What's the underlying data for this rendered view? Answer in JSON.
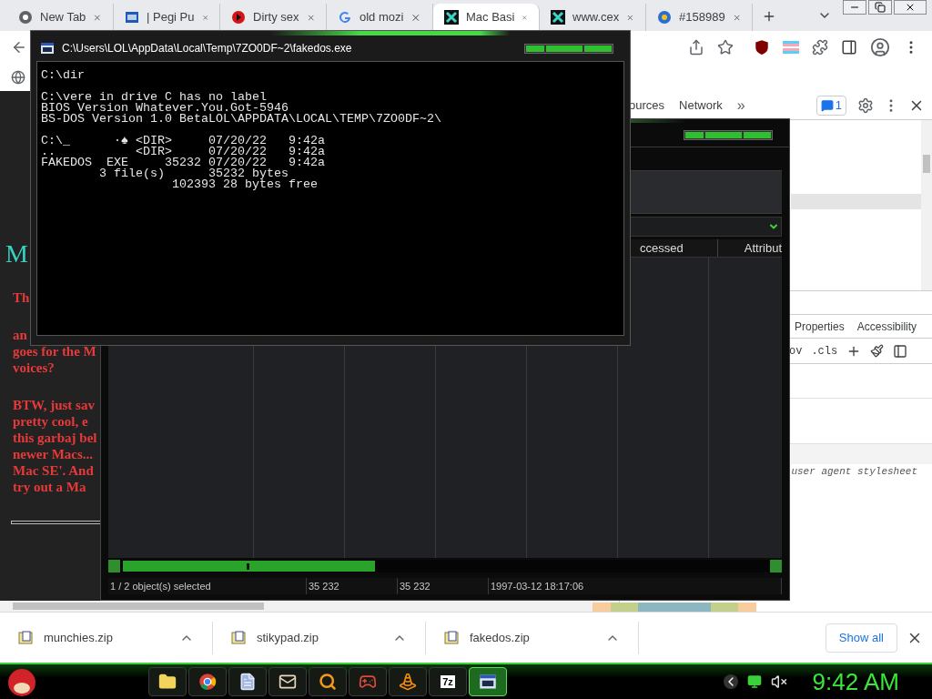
{
  "browser": {
    "tabs": [
      {
        "kind": "chrome",
        "title": "New Tab",
        "selected": false
      },
      {
        "kind": "square",
        "title": "| Pegi Pu",
        "selected": false
      },
      {
        "kind": "red",
        "title": "Dirty sex",
        "selected": false
      },
      {
        "kind": "google",
        "title": "old mozi",
        "selected": false
      },
      {
        "kind": "teal",
        "title": "Mac Basi",
        "selected": true
      },
      {
        "kind": "teal",
        "title": "www.cex",
        "selected": false
      },
      {
        "kind": "edge",
        "title": "#158989",
        "selected": false
      }
    ]
  },
  "page": {
    "heading": "M",
    "paragraphs": [
      [
        "Th"
      ],
      [
        "an",
        "goes for the M",
        "voices?"
      ],
      [
        "BTW, just sav",
        "pretty cool, e",
        "this garbaj bel",
        "newer Macs...",
        "Mac SE'. And",
        "try out a Ma"
      ]
    ]
  },
  "devtools": {
    "tabs": [
      {
        "label": "ources",
        "selected": false
      },
      {
        "label": "Network",
        "selected": false
      }
    ],
    "more": "»",
    "issues": "1",
    "panes": [
      {
        "label": "Properties",
        "selected": false
      },
      {
        "label": "Accessibility",
        "selected": false
      }
    ],
    "filter_buttons": [
      "ov",
      ".cls"
    ],
    "stylesheet_note": "user agent stylesheet"
  },
  "file_manager": {
    "columns": [
      "ccessed",
      "Attribut"
    ],
    "status": [
      "1 / 2 object(s) selected",
      "35 232",
      "35 232",
      "1997-03-12 18:17:06"
    ]
  },
  "console": {
    "title": "C:\\Users\\LOL\\AppData\\Local\\Temp\\7ZO0DF~2\\fakedos.exe",
    "blocks": [
      [
        "C:\\dir"
      ],
      [
        "C:\\vere in drive C has no label",
        "BIOS Version Whatever.You.Got-5946",
        "BS-DOS Version 1.0 BetaLOL\\APPDATA\\LOCAL\\TEMP\\7ZO0DF~2\\"
      ],
      [
        "C:\\_      ·♠ <DIR>     07/20/22   9:42a",
        "..           <DIR>     07/20/22   9:42a",
        "FAKEDOS  EXE     35232 07/20/22   9:42a",
        "        3 file(s)      35232 bytes",
        "                  102393 28 bytes free"
      ]
    ]
  },
  "downloads": {
    "items": [
      "munchies.zip",
      "stikypad.zip",
      "fakedos.zip"
    ],
    "show_all": "Show all"
  },
  "taskbar": {
    "apps": [
      {
        "kind": "folder",
        "selected": false
      },
      {
        "kind": "chrome",
        "selected": false
      },
      {
        "kind": "document",
        "selected": false
      },
      {
        "kind": "mail",
        "selected": false
      },
      {
        "kind": "search",
        "selected": false
      },
      {
        "kind": "game",
        "selected": false
      },
      {
        "kind": "cone",
        "selected": false
      },
      {
        "kind": "archive",
        "label": "7z",
        "selected": false
      },
      {
        "kind": "terminal",
        "selected": true
      }
    ],
    "clock": "9:42 AM"
  }
}
